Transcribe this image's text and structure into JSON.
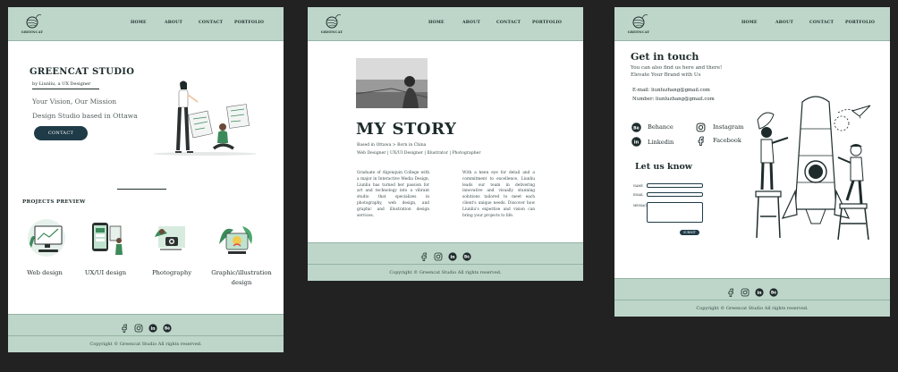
{
  "brand": {
    "name": "GREENCAT"
  },
  "nav": [
    "HOME",
    "ABOUT",
    "CONTACT",
    "PORTFOLIO"
  ],
  "home": {
    "studio": "GREENCAT STUDIO",
    "byline": "by Liunliu, a UX Designer",
    "tagline1": "Your Vision, Our Mission",
    "tagline2": "Design Studio based in Ottawa",
    "contact_button": "CONTACT",
    "projects_title": "PROJECTS PREVIEW",
    "projects": [
      "Web design",
      "UX/UI design",
      "Photography",
      "Graphic/illustration design"
    ]
  },
  "story": {
    "title": "MY STORY",
    "meta1": "Based in Ottawa > Born in China",
    "meta2": "Web Designer | UX/UI Designer | Illustrator | Photographer",
    "col1": "Graduate of Algonquin College with a major in Interactive Media Design, Liunliu has turned her passion for art and technology into a vibrant studio that specializes in photography, web design, and graphic and illustration design services.",
    "col2": "With a keen eye for detail and a commitment to excellence, Liunliu leads our team in delivering innovative and visually stunning solutions tailored to meet each client's unique needs. Discover how Liunliu's expertise and vision can bring your projects to life."
  },
  "contact": {
    "title": "Get in touch",
    "sub1": "You can also find us here and there!",
    "sub2": "Elevate Your Brand with Us",
    "email": "E-mail: liunluzhang@gmail.com",
    "number": "Number: liunluzhang@gmail.com",
    "social": [
      "Behance",
      "Instagram",
      "Linkedin",
      "Facebook"
    ],
    "form_title": "Let us know",
    "form_labels": [
      "NAME",
      "EMAIL",
      "MESSAGE"
    ],
    "submit": "SUBMIT"
  },
  "footer": {
    "copyright": "Copyright © Greencat Studio All rights reserved."
  },
  "colors": {
    "header": "#bdd6c9",
    "button": "#1f3b48",
    "accent_green": "#3c8a5a"
  }
}
